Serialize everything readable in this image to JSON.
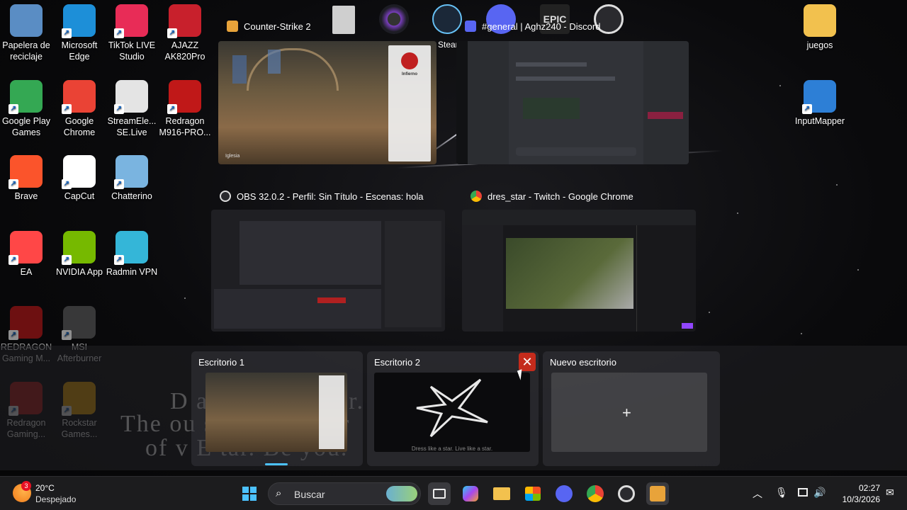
{
  "desktop_icons": [
    {
      "label": "Papelera de reciclaje",
      "icon": "recycle-bin-icon",
      "color": "#5a8dc4"
    },
    {
      "label": "Microsoft Edge",
      "icon": "edge-icon",
      "color": "#1d8fd8"
    },
    {
      "label": "TikTok LIVE Studio",
      "icon": "tiktok-icon",
      "color": "#e82c57"
    },
    {
      "label": "AJAZZ AK820Pro",
      "icon": "ajazz-icon",
      "color": "#c8202c"
    },
    {
      "label": "Google Play Games",
      "icon": "play-games-icon",
      "color": "#34a853"
    },
    {
      "label": "Google Chrome",
      "icon": "chrome-icon",
      "color": "#ea4335"
    },
    {
      "label": "StreamEle... SE.Live",
      "icon": "streamelements-icon",
      "color": "#e4e4e4"
    },
    {
      "label": "Redragon M916-PRO...",
      "icon": "redragon-icon",
      "color": "#c01818"
    },
    {
      "label": "Brave",
      "icon": "brave-icon",
      "color": "#fb542b"
    },
    {
      "label": "CapCut",
      "icon": "capcut-icon",
      "color": "#ffffff"
    },
    {
      "label": "Chatterino",
      "icon": "chatterino-icon",
      "color": "#7ab4e0"
    },
    {
      "label": "EA",
      "icon": "ea-icon",
      "color": "#ff4747"
    },
    {
      "label": "NVIDIA App",
      "icon": "nvidia-icon",
      "color": "#76b900"
    },
    {
      "label": "Radmin VPN",
      "icon": "radmin-icon",
      "color": "#34b6d8"
    },
    {
      "label": "REDRAGON Gaming M...",
      "icon": "redragon-icon",
      "color": "#c01818"
    },
    {
      "label": "MSI Afterburner",
      "icon": "msi-afterburner-icon",
      "color": "#606060"
    },
    {
      "label": "Redragon Gaming...",
      "icon": "redragon-icon",
      "color": "#c01818"
    },
    {
      "label": "Rockstar Games...",
      "icon": "rockstar-icon",
      "color": "#f4a900"
    },
    {
      "label": "juegos",
      "icon": "folder-icon",
      "color": "#f2c14e"
    },
    {
      "label": "InputMapper",
      "icon": "inputmapper-icon",
      "color": "#2d7fd6"
    }
  ],
  "task_view": {
    "windows": [
      {
        "title": "Counter-Strike 2",
        "icon": "cs2-icon"
      },
      {
        "title": "#general | Aghz240 - Discord",
        "icon": "discord-icon"
      },
      {
        "title": "OBS 32.0.2 - Perfil: Sin Título - Escenas: hola",
        "icon": "obs-icon"
      },
      {
        "title": "dres_star - Twitch - Google Chrome",
        "icon": "chrome-icon"
      }
    ],
    "partial_labels": {
      "steam": "Stear"
    },
    "game_thumb": {
      "panel_title": "Infierno",
      "location": "Iglesia"
    },
    "desktops": [
      {
        "label": "Escritorio 1"
      },
      {
        "label": "Escritorio 2"
      },
      {
        "label": "Nuevo escritorio"
      }
    ],
    "overlay_lines": [
      "D       a      ve like a star.",
      "The         ou       s and the star",
      "of v          E       tar. Be you."
    ],
    "desktop_caption": "Dress like a star. Live like a star."
  },
  "taskbar": {
    "weather": {
      "temp": "20°C",
      "condition": "Despejado",
      "badge": "3"
    },
    "search_placeholder": "Buscar",
    "clock": {
      "time": "02:27",
      "date": "10/3/2026"
    },
    "pinned": [
      "start-icon",
      "task-view-icon",
      "copilot-icon",
      "file-explorer-icon",
      "microsoft-store-icon",
      "discord-icon",
      "chrome-icon",
      "obs-icon",
      "cs2-icon"
    ]
  },
  "colors": {
    "accent_red": "#c42b1c",
    "taskbar": "#1c1c1e",
    "twitch_purple": "#9146ff",
    "discord": "#5865f2"
  }
}
